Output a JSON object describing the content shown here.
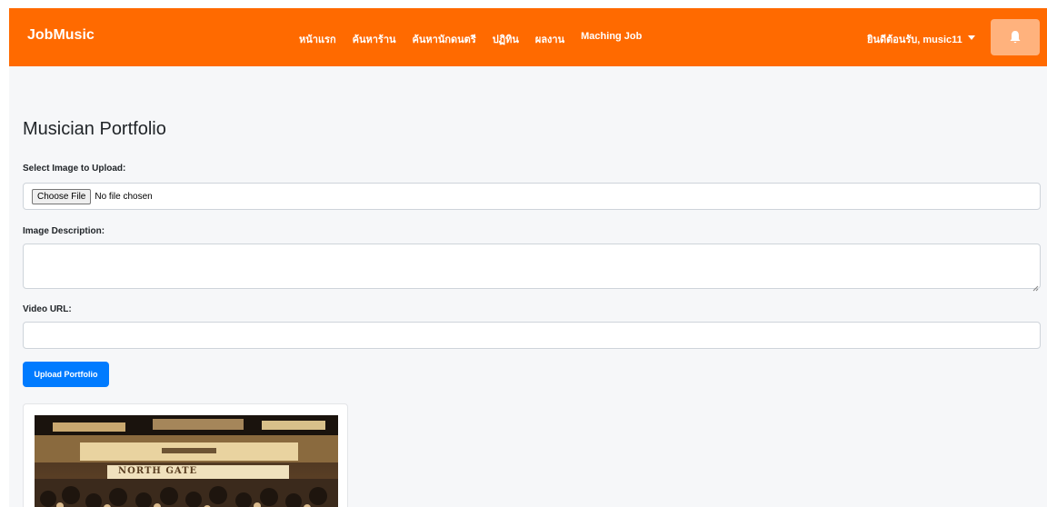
{
  "navbar": {
    "brand": "JobMusic",
    "links": [
      {
        "label": "หน้าแรก"
      },
      {
        "label": "ค้นหาร้าน"
      },
      {
        "label": "ค้นหานักดนตรี"
      },
      {
        "label": "ปฏิทิน"
      },
      {
        "label": "ผลงาน"
      },
      {
        "label": "Maching Job"
      }
    ],
    "user_greeting": "ยินดีต้อนรับ, music11",
    "bell_icon": "bell-icon",
    "colors": {
      "bar": "#ff6a00",
      "bell_button": "#ffb27d"
    }
  },
  "page": {
    "title": "Musician Portfolio"
  },
  "form": {
    "image_label": "Select Image to Upload:",
    "choose_file_label": "Choose File",
    "file_status": "No file chosen",
    "description_label": "Image Description:",
    "description_value": "",
    "video_label": "Video URL:",
    "video_value": "",
    "submit_label": "Upload Portfolio",
    "submit_color": "#007bff"
  },
  "portfolio": {
    "items": [
      {
        "image": "photo of a crowded street-front venue with a North Gate sign",
        "sign_text": "NORTH GATE"
      }
    ]
  }
}
